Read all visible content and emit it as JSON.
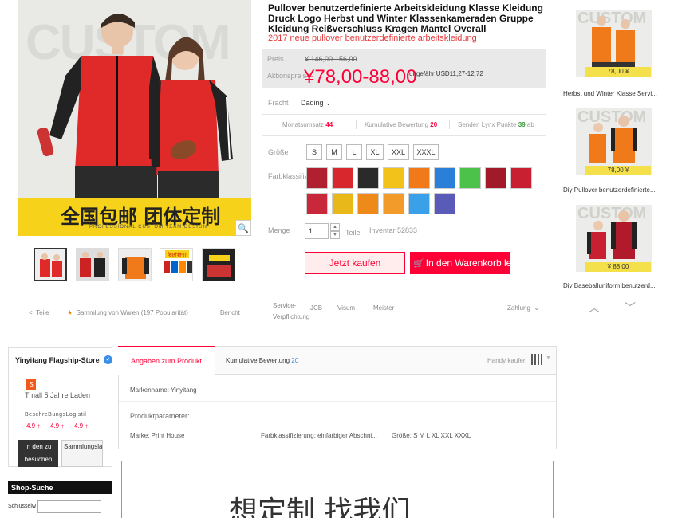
{
  "product": {
    "title": "Pullover benutzerdefinierte Arbeitskleidung Klasse Kleidung Druck Logo Herbst und Winter Klassenkameraden Gruppe Kleidung Reißverschluss Kragen Mantel Overall",
    "subtitle": "2017 neue pullover benutzerdefinierte arbeitskleidung",
    "image_watermark": "CUSTOM",
    "banner_text": "全国包邮 团体定制",
    "banner_small": "PROFESSIONAL  CUSTOM  TEAM  DESIGN",
    "thumb_badge_text": "限时特价"
  },
  "price": {
    "price_label": "Preis",
    "old_price": "¥ 146,00-156,00",
    "promo_label": "Aktionspreis",
    "promo_price": "¥78,00-88,00",
    "approx": "ungefähr USD11,27-12,72"
  },
  "shipping": {
    "label": "Fracht",
    "value": "Daqing"
  },
  "stats": {
    "monthly_label": "Monatsumsatz",
    "monthly_value": "44",
    "reviews_label": "Kumulative Bewertung",
    "reviews_value": "20",
    "points_label": "Senden Lynx Punkte",
    "points_value": "39",
    "points_suffix": "ab"
  },
  "options": {
    "size_label": "Größe",
    "sizes": [
      "S",
      "M",
      "L",
      "XL",
      "XXL",
      "XXXL"
    ],
    "color_label": "Farbklassifizierung",
    "color_label_visible": "Farbklassifiz",
    "quantity_label": "Menge",
    "quantity_value": "1",
    "quantity_unit": "Teile",
    "stock": "Inventar 52833"
  },
  "buttons": {
    "buy": "Jetzt kaufen",
    "cart": "In den Warenkorb legen"
  },
  "actions": {
    "share": "Teile",
    "collect": "Sammlung von Waren (197 Popularität)",
    "report": "Bericht",
    "service_label": "Service-Verpflichtung",
    "service_items": [
      "JCB",
      "Visum",
      "Meister"
    ],
    "payment": "Zahlung"
  },
  "recommendations": [
    {
      "price": "78,00 ¥",
      "caption": "Herbst und Winter Klasse Servi..."
    },
    {
      "price": "78,00 ¥",
      "caption": "Diy Pullover benutzerdefinierte..."
    },
    {
      "price": "¥ 88,00",
      "caption": "Diy Baseballuniform benutzerd..."
    }
  ],
  "shop": {
    "name": "Yinyitang Flagship-Store",
    "badge": "S",
    "tmall": "Tmall 5 Jahre Laden",
    "rating_labels": [
      "Beschreibung",
      "Bedienung",
      "Logistik"
    ],
    "rating_labels_visible": "BeschreBungsLogistil",
    "ratings": [
      "4.9 ↑",
      "4.9 ↑",
      "4.9 ↑"
    ],
    "enter_button": "In den zu besuchen",
    "collect_button": "Sammlungsla",
    "search_title": "Shop-Suche",
    "keyword_label": "Schlüsselw"
  },
  "tabs": {
    "details": "Angaben zum Produkt",
    "reviews": "Kumulative Bewertung",
    "reviews_count": "20",
    "mobile": "Handy kaufen"
  },
  "params": {
    "brand": "Markenname: Yinyitang",
    "heading": "Produktparameter:",
    "mark": "Marke: Print House",
    "color": "Farbklassifizierung: einfarbiger Abschni...",
    "size": "Größe: S M L XL XXL XXXL"
  },
  "banner_bottom": "想定制 找我们",
  "colors": {
    "accent": "#ff0036",
    "banner_yellow": "#f7d21a",
    "price_bg": "#e9e9e9"
  }
}
